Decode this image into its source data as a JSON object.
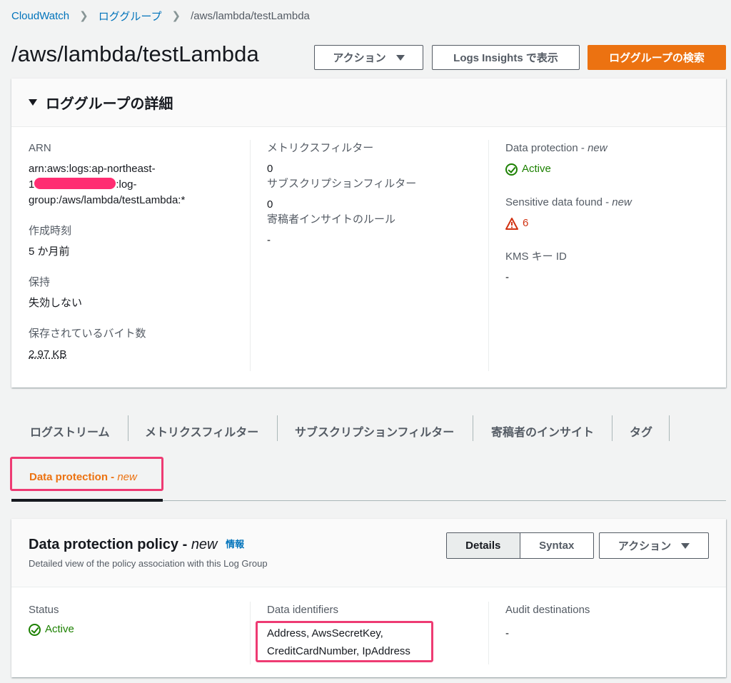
{
  "breadcrumb": [
    "CloudWatch",
    "ロググループ",
    "/aws/lambda/testLambda"
  ],
  "page_title": "/aws/lambda/testLambda",
  "header_buttons": {
    "actions": "アクション",
    "logs_insights": "Logs Insights で表示",
    "search": "ロググループの検索"
  },
  "details": {
    "title": "ロググループの詳細",
    "arn_label": "ARN",
    "arn_line1": "arn:aws:logs:ap-northeast-",
    "arn_line2_prefix": "1",
    "arn_line2_suffix": ":log-",
    "arn_line3": "group:/aws/lambda/testLambda:*",
    "created_label": "作成時刻",
    "created_value": "5 か月前",
    "retention_label": "保持",
    "retention_value": "失効しない",
    "bytes_label": "保存されているバイト数",
    "bytes_value": "2.97 KB",
    "metric_filters_label": "メトリクスフィルター",
    "metric_filters_value": "0",
    "subscription_label": "サブスクリプションフィルター",
    "subscription_value": "0",
    "contributor_label": "寄稿者インサイトのルール",
    "contributor_value": "-",
    "data_protection_label": "Data protection - ",
    "data_protection_new": "new",
    "data_protection_value": "Active",
    "sensitive_label": "Sensitive data found - ",
    "sensitive_new": "new",
    "sensitive_value": "6",
    "kms_label": "KMS キー ID",
    "kms_value": "-"
  },
  "tabs": [
    "ログストリーム",
    "メトリクスフィルター",
    "サブスクリプションフィルター",
    "寄稿者のインサイト",
    "タグ"
  ],
  "active_tab": {
    "label": "Data protection - ",
    "new": "new"
  },
  "policy": {
    "title": "Data protection policy - ",
    "title_new": "new",
    "info": "情報",
    "description": "Detailed view of the policy association with this Log Group",
    "details_btn": "Details",
    "syntax_btn": "Syntax",
    "actions_btn": "アクション",
    "status_label": "Status",
    "status_value": "Active",
    "identifiers_label": "Data identifiers",
    "identifiers_line1": "Address, AwsSecretKey,",
    "identifiers_line2": "CreditCardNumber, IpAddress",
    "audit_label": "Audit destinations",
    "audit_value": "-"
  },
  "colors": {
    "accent": "#ec7211",
    "link": "#0073bb",
    "success": "#1d8102",
    "error": "#d13212",
    "highlight": "#ee3b73"
  }
}
